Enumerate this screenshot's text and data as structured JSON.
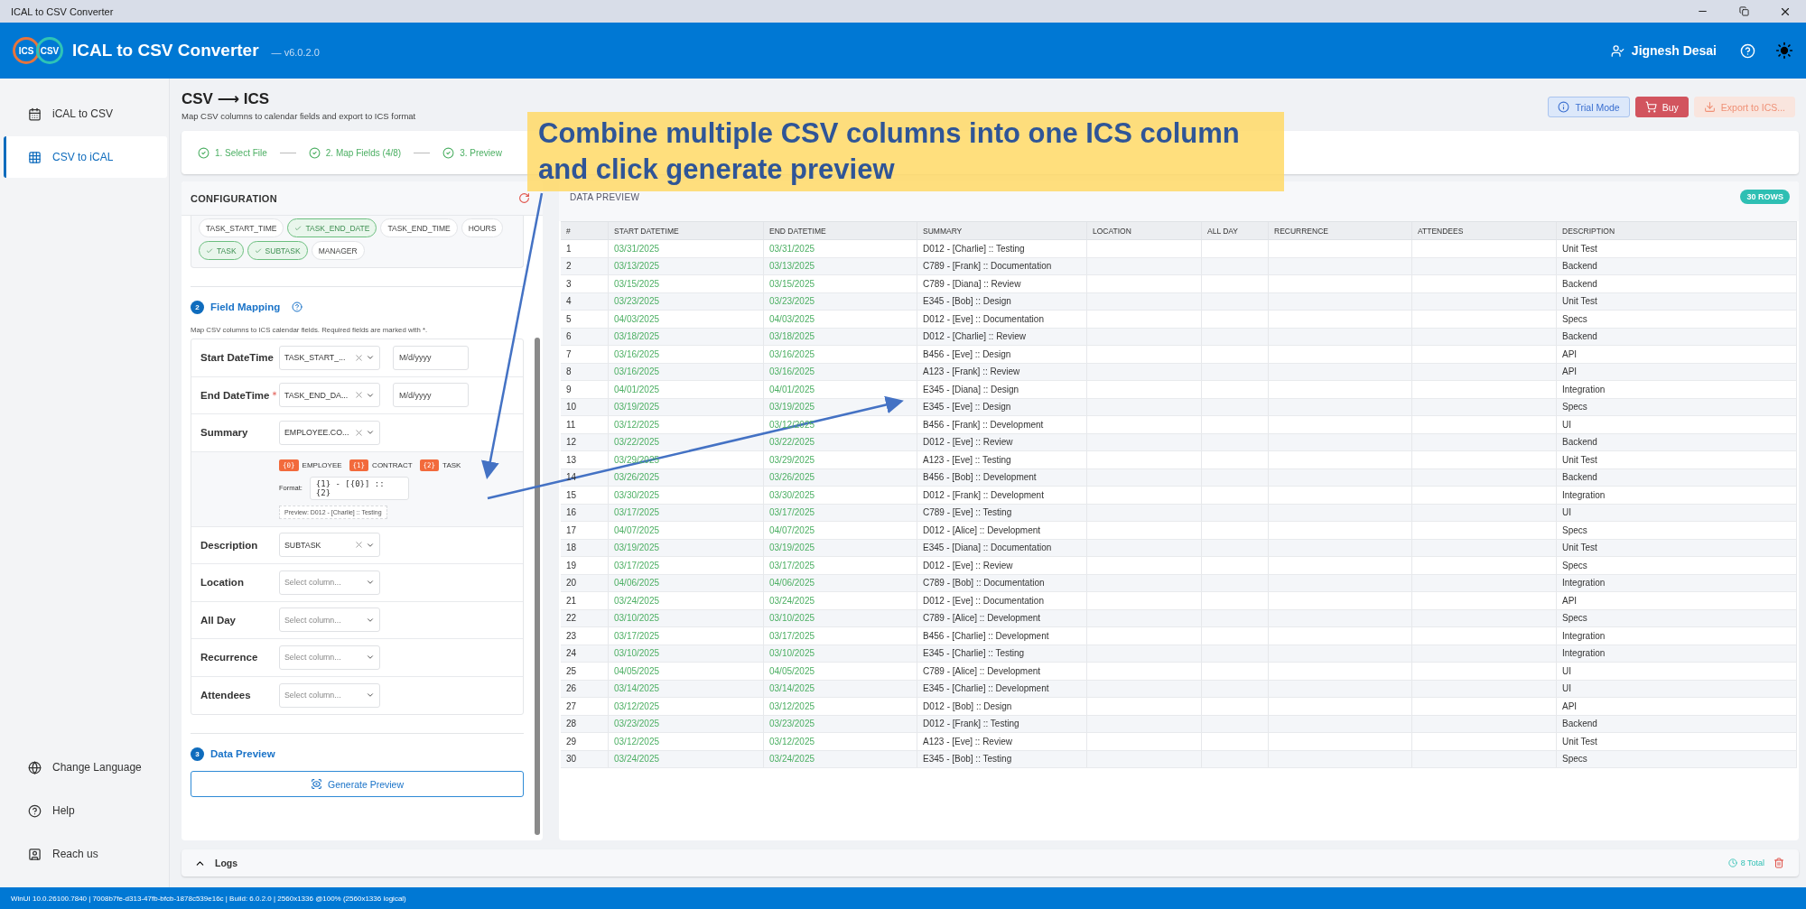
{
  "window": {
    "title": "ICAL to CSV Converter"
  },
  "header": {
    "app_name": "ICAL to CSV Converter",
    "version": "— v6.0.2.0",
    "logo_left": "ICS",
    "logo_right": "CSV",
    "user": "Jignesh Desai"
  },
  "sidebar": {
    "items": [
      {
        "label": "iCAL to CSV",
        "selected": false
      },
      {
        "label": "CSV to iCAL",
        "selected": true
      }
    ],
    "footer_items": [
      {
        "label": "Change Language"
      },
      {
        "label": "Help"
      },
      {
        "label": "Reach us"
      }
    ]
  },
  "page": {
    "title": "CSV ⟶ ICS",
    "subtitle": "Map CSV columns to calendar fields and export to ICS format"
  },
  "actions": [
    {
      "label": "Trial Mode",
      "kind": "info",
      "disabled": false
    },
    {
      "label": "Buy",
      "kind": "buy",
      "disabled": false
    },
    {
      "label": "Export to ICS...",
      "kind": "export",
      "disabled": true
    }
  ],
  "steps": [
    {
      "label": "1. Select File",
      "done": true
    },
    {
      "label": "2. Map Fields (4/8)",
      "done": true
    },
    {
      "label": "3. Preview",
      "done": true
    }
  ],
  "configuration": {
    "title": "CONFIGURATION",
    "chips": [
      {
        "label": "TASK_START_TIME",
        "selected": false
      },
      {
        "label": "TASK_END_DATE",
        "selected": true
      },
      {
        "label": "TASK_END_TIME",
        "selected": false
      },
      {
        "label": "HOURS",
        "selected": false
      },
      {
        "label": "TASK",
        "selected": true
      },
      {
        "label": "SUBTASK",
        "selected": true
      },
      {
        "label": "MANAGER",
        "selected": false
      }
    ],
    "field_mapping": {
      "number": "2",
      "title": "Field Mapping",
      "hint": "Map CSV columns to ICS calendar fields. Required fields are marked with *.",
      "rows": [
        {
          "label": "Start DateTime",
          "required": false,
          "value": "TASK_START_...",
          "format": "M/d/yyyy"
        },
        {
          "label": "End DateTime",
          "required": true,
          "value": "TASK_END_DA...",
          "format": "M/d/yyyy"
        },
        {
          "label": "Summary",
          "required": false,
          "value": "EMPLOYEE.CO...",
          "combine": {
            "tokens": [
              {
                "index": "{0}",
                "label": "EMPLOYEE"
              },
              {
                "index": "{1}",
                "label": "CONTRACT"
              },
              {
                "index": "{2}",
                "label": "TASK"
              }
            ],
            "format_label": "Format:",
            "format": "{1} - [{0}] :: {2}",
            "preview": "Preview: D012 - [Charlie] :: Testing"
          }
        },
        {
          "label": "Description",
          "required": false,
          "value": "SUBTASK"
        },
        {
          "label": "Location",
          "required": false,
          "placeholder": "Select column..."
        },
        {
          "label": "All Day",
          "required": false,
          "placeholder": "Select column..."
        },
        {
          "label": "Recurrence",
          "required": false,
          "placeholder": "Select column..."
        },
        {
          "label": "Attendees",
          "required": false,
          "placeholder": "Select column..."
        }
      ]
    },
    "data_preview": {
      "number": "3",
      "title": "Data Preview",
      "button": "Generate Preview"
    }
  },
  "preview": {
    "title": "DATA PREVIEW",
    "row_count": "30 ROWS",
    "columns": [
      "#",
      "START DATETIME",
      "END DATETIME",
      "SUMMARY",
      "LOCATION",
      "ALL DAY",
      "RECURRENCE",
      "ATTENDEES",
      "DESCRIPTION"
    ],
    "rows": [
      {
        "number": "1",
        "start": "03/31/2025",
        "end": "03/31/2025",
        "summary": "D012 - [Charlie] :: Testing",
        "description": "Unit Test"
      },
      {
        "number": "2",
        "start": "03/13/2025",
        "end": "03/13/2025",
        "summary": "C789 - [Frank] :: Documentation",
        "description": "Backend"
      },
      {
        "number": "3",
        "start": "03/15/2025",
        "end": "03/15/2025",
        "summary": "C789 - [Diana] :: Review",
        "description": "Backend"
      },
      {
        "number": "4",
        "start": "03/23/2025",
        "end": "03/23/2025",
        "summary": "E345 - [Bob] :: Design",
        "description": "Unit Test"
      },
      {
        "number": "5",
        "start": "04/03/2025",
        "end": "04/03/2025",
        "summary": "D012 - [Eve] :: Documentation",
        "description": "Specs"
      },
      {
        "number": "6",
        "start": "03/18/2025",
        "end": "03/18/2025",
        "summary": "D012 - [Charlie] :: Review",
        "description": "Backend"
      },
      {
        "number": "7",
        "start": "03/16/2025",
        "end": "03/16/2025",
        "summary": "B456 - [Eve] :: Design",
        "description": "API"
      },
      {
        "number": "8",
        "start": "03/16/2025",
        "end": "03/16/2025",
        "summary": "A123 - [Frank] :: Review",
        "description": "API"
      },
      {
        "number": "9",
        "start": "04/01/2025",
        "end": "04/01/2025",
        "summary": "E345 - [Diana] :: Design",
        "description": "Integration"
      },
      {
        "number": "10",
        "start": "03/19/2025",
        "end": "03/19/2025",
        "summary": "E345 - [Eve] :: Design",
        "description": "Specs"
      },
      {
        "number": "11",
        "start": "03/12/2025",
        "end": "03/12/2025",
        "summary": "B456 - [Frank] :: Development",
        "description": "UI"
      },
      {
        "number": "12",
        "start": "03/22/2025",
        "end": "03/22/2025",
        "summary": "D012 - [Eve] :: Review",
        "description": "Backend"
      },
      {
        "number": "13",
        "start": "03/29/2025",
        "end": "03/29/2025",
        "summary": "A123 - [Eve] :: Testing",
        "description": "Unit Test"
      },
      {
        "number": "14",
        "start": "03/26/2025",
        "end": "03/26/2025",
        "summary": "B456 - [Bob] :: Development",
        "description": "Backend"
      },
      {
        "number": "15",
        "start": "03/30/2025",
        "end": "03/30/2025",
        "summary": "D012 - [Frank] :: Development",
        "description": "Integration"
      },
      {
        "number": "16",
        "start": "03/17/2025",
        "end": "03/17/2025",
        "summary": "C789 - [Eve] :: Testing",
        "description": "UI"
      },
      {
        "number": "17",
        "start": "04/07/2025",
        "end": "04/07/2025",
        "summary": "D012 - [Alice] :: Development",
        "description": "Specs"
      },
      {
        "number": "18",
        "start": "03/19/2025",
        "end": "03/19/2025",
        "summary": "E345 - [Diana] :: Documentation",
        "description": "Unit Test"
      },
      {
        "number": "19",
        "start": "03/17/2025",
        "end": "03/17/2025",
        "summary": "D012 - [Eve] :: Review",
        "description": "Specs"
      },
      {
        "number": "20",
        "start": "04/06/2025",
        "end": "04/06/2025",
        "summary": "C789 - [Bob] :: Documentation",
        "description": "Integration"
      },
      {
        "number": "21",
        "start": "03/24/2025",
        "end": "03/24/2025",
        "summary": "D012 - [Eve] :: Documentation",
        "description": "API"
      },
      {
        "number": "22",
        "start": "03/10/2025",
        "end": "03/10/2025",
        "summary": "C789 - [Alice] :: Development",
        "description": "Specs"
      },
      {
        "number": "23",
        "start": "03/17/2025",
        "end": "03/17/2025",
        "summary": "B456 - [Charlie] :: Development",
        "description": "Integration"
      },
      {
        "number": "24",
        "start": "03/10/2025",
        "end": "03/10/2025",
        "summary": "E345 - [Charlie] :: Testing",
        "description": "Integration"
      },
      {
        "number": "25",
        "start": "04/05/2025",
        "end": "04/05/2025",
        "summary": "C789 - [Alice] :: Development",
        "description": "UI"
      },
      {
        "number": "26",
        "start": "03/14/2025",
        "end": "03/14/2025",
        "summary": "E345 - [Charlie] :: Development",
        "description": "UI"
      },
      {
        "number": "27",
        "start": "03/12/2025",
        "end": "03/12/2025",
        "summary": "D012 - [Bob] :: Design",
        "description": "API"
      },
      {
        "number": "28",
        "start": "03/23/2025",
        "end": "03/23/2025",
        "summary": "D012 - [Frank] :: Testing",
        "description": "Backend"
      },
      {
        "number": "29",
        "start": "03/12/2025",
        "end": "03/12/2025",
        "summary": "A123 - [Eve] :: Review",
        "description": "Unit Test"
      },
      {
        "number": "30",
        "start": "03/24/2025",
        "end": "03/24/2025",
        "summary": "E345 - [Bob] :: Testing",
        "description": "Specs"
      }
    ]
  },
  "logs": {
    "title": "Logs",
    "total": "8 Total"
  },
  "status_bar": "WinUI 10.0.26100.7840 | 7008b7fe-d313-47fb-bfcb-1878c539e16c | Build: 6.0.2.0 | 2560x1336 @100% (2560x1336 logical)",
  "callout": {
    "text": "Combine multiple CSV columns into one ICS column and click generate preview"
  }
}
